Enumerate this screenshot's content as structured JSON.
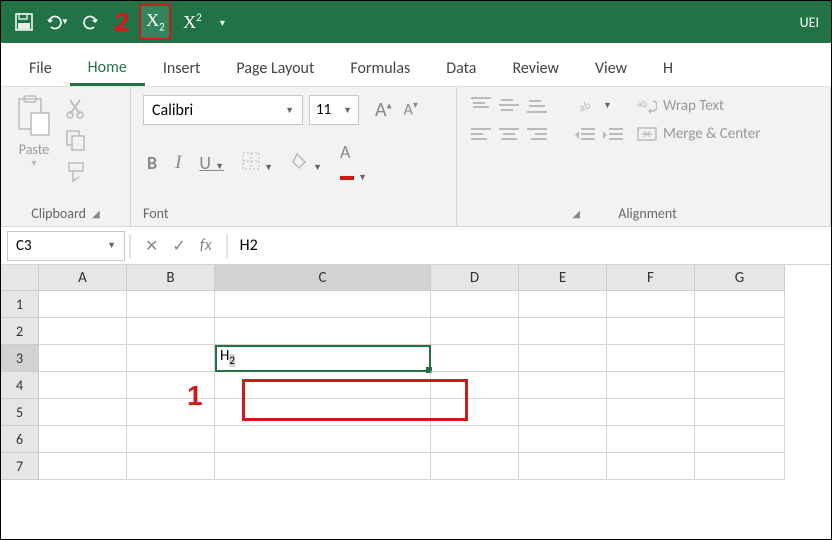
{
  "qat": {
    "title_partial": "UEI",
    "subscript_label": "Subscript",
    "superscript_label": "Superscript"
  },
  "annotations": {
    "num1": "1",
    "num2": "2"
  },
  "tabs": [
    "File",
    "Home",
    "Insert",
    "Page Layout",
    "Formulas",
    "Data",
    "Review",
    "View",
    "H"
  ],
  "active_tab": "Home",
  "clipboard": {
    "paste_label": "Paste",
    "group_label": "Clipboard"
  },
  "font": {
    "name": "Calibri",
    "size": "11",
    "group_label": "Font",
    "bold": "B",
    "italic": "I",
    "underline": "U",
    "grow": "A",
    "shrink": "A"
  },
  "alignment": {
    "group_label": "Alignment",
    "wrap": "Wrap Text",
    "merge": "Merge & Center"
  },
  "formula_bar": {
    "name_box": "C3",
    "fx": "fx",
    "value": "H2"
  },
  "grid": {
    "columns": [
      "A",
      "B",
      "C",
      "D",
      "E",
      "F",
      "G"
    ],
    "rows": [
      "1",
      "2",
      "3",
      "4",
      "5",
      "6",
      "7"
    ],
    "active_cell": "C3",
    "active_value_display": "H",
    "active_value_sub": "2"
  }
}
